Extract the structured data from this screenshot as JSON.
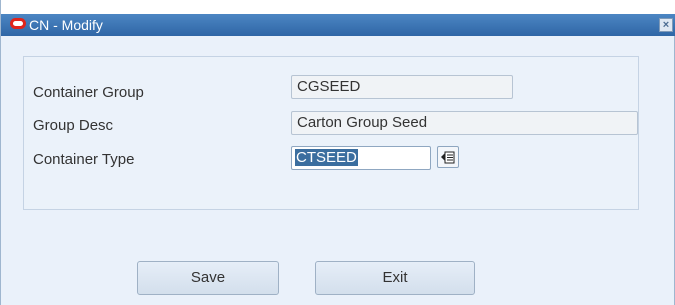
{
  "window": {
    "title": "CN - Modify"
  },
  "form": {
    "container_group": {
      "label": "Container Group",
      "value": "CGSEED"
    },
    "group_desc": {
      "label": "Group Desc",
      "value": "Carton Group Seed"
    },
    "container_type": {
      "label": "Container Type",
      "value": "CTSEED"
    }
  },
  "buttons": {
    "save": "Save",
    "exit": "Exit"
  },
  "colors": {
    "title_bar": "#3a74b5",
    "selection": "#3b6e9f",
    "brand": "#e0241b"
  },
  "icons": {
    "logo": "oracle-logo-icon",
    "close": "close-icon",
    "lov": "list-of-values-icon"
  }
}
